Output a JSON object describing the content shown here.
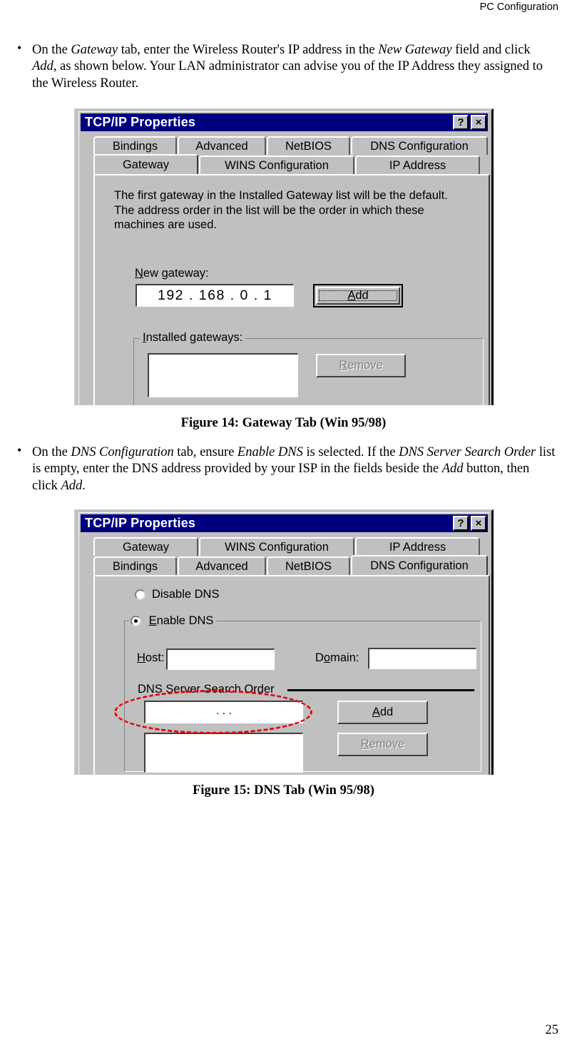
{
  "page": {
    "header_title": "PC Configuration",
    "page_number": "25"
  },
  "bullets": [
    {
      "id": "gateway-step",
      "segments": [
        {
          "text": "On the ",
          "style": "normal"
        },
        {
          "text": "Gateway",
          "style": "italic"
        },
        {
          "text": " tab, enter the Wireless Router's IP address in the ",
          "style": "normal"
        },
        {
          "text": "New Gateway",
          "style": "italic"
        },
        {
          "text": " field and click ",
          "style": "normal"
        },
        {
          "text": "Add",
          "style": "italic"
        },
        {
          "text": ", as shown below. Your LAN administrator can advise you of the IP Address they assigned to the Wireless Router.",
          "style": "normal"
        }
      ]
    },
    {
      "id": "dns-step",
      "segments": [
        {
          "text": "On the ",
          "style": "normal"
        },
        {
          "text": "DNS Configuration",
          "style": "italic"
        },
        {
          "text": " tab, ensure ",
          "style": "normal"
        },
        {
          "text": "Enable DNS",
          "style": "italic"
        },
        {
          "text": " is selected. If the ",
          "style": "normal"
        },
        {
          "text": "DNS Server Search Order",
          "style": "italic"
        },
        {
          "text": " list is empty, enter the DNS address provided by your ISP in the fields beside the ",
          "style": "normal"
        },
        {
          "text": "Add",
          "style": "italic"
        },
        {
          "text": " button, then click ",
          "style": "normal"
        },
        {
          "text": "Add",
          "style": "italic"
        },
        {
          "text": ".",
          "style": "normal"
        }
      ]
    }
  ],
  "figures": [
    {
      "id": "figure-14",
      "caption": "Figure 14: Gateway Tab (Win 95/98)"
    },
    {
      "id": "figure-15",
      "caption": "Figure 15: DNS Tab (Win 95/98)"
    }
  ],
  "gateway_dialog": {
    "title": "TCP/IP Properties",
    "help_button": "?",
    "close_button": "×",
    "tabs_row_top": [
      {
        "label": "Bindings",
        "selected": false
      },
      {
        "label": "Advanced",
        "selected": false
      },
      {
        "label": "NetBIOS",
        "selected": false
      },
      {
        "label": "DNS Configuration",
        "selected": false
      }
    ],
    "tabs_row_bottom": [
      {
        "label": "Gateway",
        "selected": true
      },
      {
        "label": "WINS Configuration",
        "selected": false
      },
      {
        "label": "IP Address",
        "selected": false
      }
    ],
    "description": "The first gateway in the Installed Gateway list will be the default. The address order in the list will be the order in which these machines are used.",
    "new_gateway_label_pre": "N",
    "new_gateway_label_post": "ew gateway:",
    "new_gateway_value": "192 . 168 .   0   .   1",
    "add_button_pre": "A",
    "add_button_post": "dd",
    "installed_group_pre": "I",
    "installed_group_post": "nstalled gateways:",
    "remove_button_pre": "R",
    "remove_button_post": "emove"
  },
  "dns_dialog": {
    "title": "TCP/IP Properties",
    "help_button": "?",
    "close_button": "×",
    "tabs_row_top": [
      {
        "label": "Gateway",
        "selected": false
      },
      {
        "label": "WINS Configuration",
        "selected": false
      },
      {
        "label": "IP Address",
        "selected": false
      }
    ],
    "tabs_row_bottom": [
      {
        "label": "Bindings",
        "selected": false
      },
      {
        "label": "Advanced",
        "selected": false
      },
      {
        "label": "NetBIOS",
        "selected": false
      },
      {
        "label": "DNS Configuration",
        "selected": true
      }
    ],
    "disable_dns_pre": "Di",
    "disable_dns_post": "sable DNS",
    "enable_dns_pre": "E",
    "enable_dns_post": "nable DNS",
    "dns_selected": "enable",
    "host_label_pre": "H",
    "host_label_post": "ost:",
    "host_value": "",
    "domain_label_pre": "D",
    "domain_label_mid": "o",
    "domain_label_post": "main:",
    "domain_value": "",
    "search_order_group": "DNS Server Search Order",
    "search_order_value": ".        .        .",
    "add_button_pre": "A",
    "add_button_post": "dd",
    "remove_button_pre": "R",
    "remove_button_post": "emove",
    "annotation": {
      "shape": "ellipse",
      "color": "#e60000"
    }
  }
}
